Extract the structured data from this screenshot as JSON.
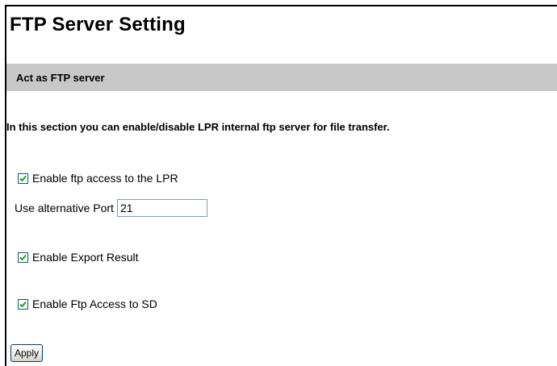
{
  "page": {
    "title": "FTP Server Setting"
  },
  "section": {
    "title": "Act as FTP server",
    "description": "In this section you can enable/disable LPR internal ftp server for file transfer."
  },
  "options": {
    "ftp_access": {
      "label": "Enable ftp access to the LPR",
      "checked": true
    },
    "alt_port": {
      "label": "Use alternative Port",
      "value": "21"
    },
    "export_result": {
      "label": "Enable Export Result",
      "checked": true
    },
    "ftp_sd": {
      "label": "Enable Ftp Access to SD",
      "checked": true
    }
  },
  "actions": {
    "apply_label": "Apply"
  },
  "colors": {
    "section_bar": "#c8c8c8",
    "checkmark": "#21a121",
    "checkbox_border": "#1c5180"
  }
}
